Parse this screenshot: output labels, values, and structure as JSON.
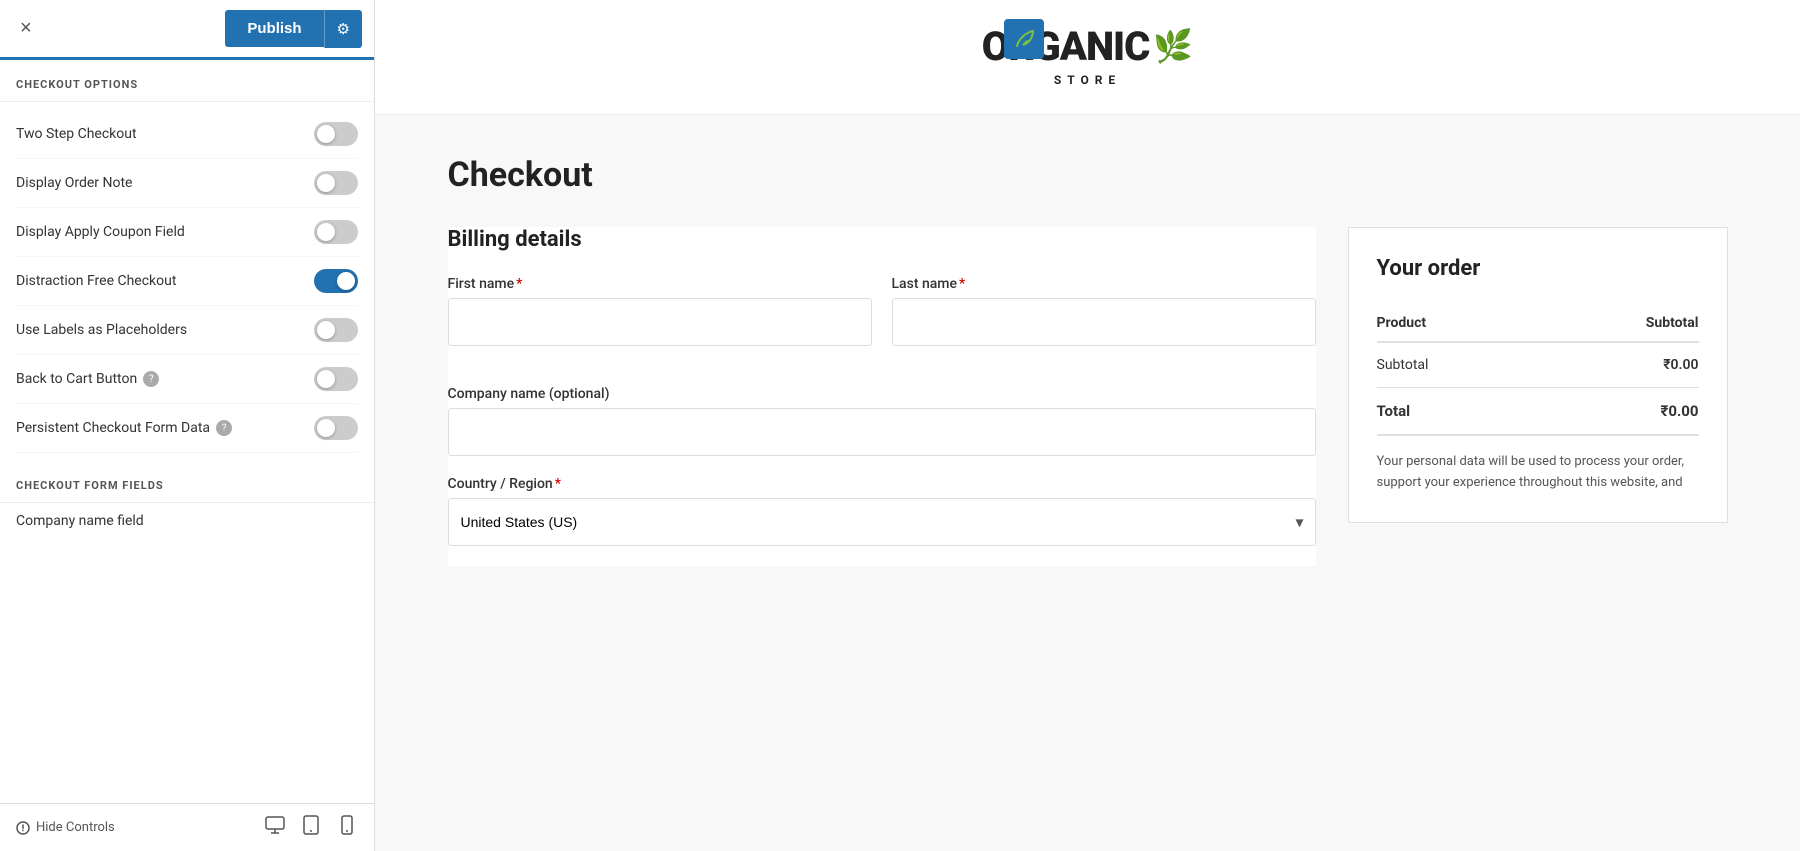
{
  "topbar": {
    "close_label": "×",
    "publish_label": "Publish",
    "settings_icon": "⚙"
  },
  "sidebar": {
    "checkout_options_heading": "CHECKOUT OPTIONS",
    "options": [
      {
        "id": "two-step",
        "label": "Two Step Checkout",
        "checked": false,
        "has_help": false
      },
      {
        "id": "display-order-note",
        "label": "Display Order Note",
        "checked": false,
        "has_help": false
      },
      {
        "id": "display-coupon",
        "label": "Display Apply Coupon Field",
        "checked": false,
        "has_help": false
      },
      {
        "id": "distraction-free",
        "label": "Distraction Free Checkout",
        "checked": true,
        "has_help": false
      },
      {
        "id": "use-labels",
        "label": "Use Labels as Placeholders",
        "checked": false,
        "has_help": false
      },
      {
        "id": "back-to-cart",
        "label": "Back to Cart Button",
        "checked": false,
        "has_help": true
      },
      {
        "id": "persistent-form",
        "label": "Persistent Checkout Form Data",
        "checked": false,
        "has_help": true
      }
    ],
    "form_fields_heading": "CHECKOUT FORM FIELDS",
    "company_field_label": "Company name field",
    "hide_controls_label": "Hide Controls",
    "device_icons": [
      "desktop",
      "tablet",
      "mobile"
    ]
  },
  "preview": {
    "logo_text": "ORGANIC",
    "logo_sub": "STORE",
    "checkout_title": "Checkout",
    "billing_title": "Billing details",
    "fields": {
      "first_name_label": "First name",
      "last_name_label": "Last name",
      "company_label": "Company name (optional)",
      "country_label": "Country / Region",
      "country_value": "United States (US)"
    },
    "order": {
      "title": "Your order",
      "col_product": "Product",
      "col_subtotal": "Subtotal",
      "row_subtotal_label": "Subtotal",
      "row_subtotal_value": "₹0.00",
      "row_total_label": "Total",
      "row_total_value": "₹0.00",
      "privacy_text": "Your personal data will be used to process your order, support your experience throughout this website, and"
    }
  }
}
